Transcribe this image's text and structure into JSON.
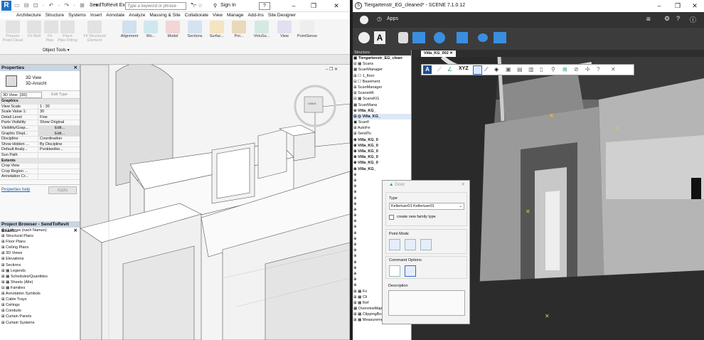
{
  "revit": {
    "logo": "R",
    "doc_title": "SendToRevit Ex...",
    "search_placeholder": "Type a keyword or phrase",
    "sign_in": "Sign In",
    "help": "?",
    "tabs": [
      "Architecture",
      "Structure",
      "Systems",
      "Insert",
      "Annotate",
      "Analyze",
      "Massing & Site",
      "Collaborate",
      "View",
      "Manage",
      "Add-Ins",
      "Site Designer"
    ],
    "ribbon": [
      {
        "label": "Prepare\nPoint Cloud",
        "grey": true
      },
      {
        "label": "Fit Wall",
        "grey": true
      },
      {
        "label": "Fit\nPipe",
        "grey": true
      },
      {
        "label": "Place\nPipe Fitting",
        "grey": true
      },
      {
        "label": "Fit Structural\nElement",
        "grey": true
      },
      {
        "label": "Alignment",
        "grey": false
      },
      {
        "label": "Wo...",
        "grey": false
      },
      {
        "label": "Model",
        "grey": false
      },
      {
        "label": "Sections",
        "grey": false
      },
      {
        "label": "Surfac...",
        "grey": false
      },
      {
        "label": "Poi...",
        "grey": false
      },
      {
        "label": "VirtuSu...",
        "grey": false
      },
      {
        "label": "View",
        "grey": false
      },
      {
        "label": "PointSense",
        "grey": false
      }
    ],
    "object_tools": "Object Tools ▾",
    "properties": {
      "header": "Properties",
      "type_name": "3D View",
      "type_sub": "3D-Ansicht",
      "selector": "3D View: {3D}",
      "edit_type": "Edit Type",
      "section_graphics": "Graphics",
      "rows": [
        [
          "View Scale",
          "1 : 30"
        ],
        [
          "Scale Value   1:",
          "30"
        ],
        [
          "Detail Level",
          "Fine"
        ],
        [
          "Parts Visibility",
          "Show Original"
        ],
        [
          "Visibility/Grap...",
          "Edit..."
        ],
        [
          "Graphic Displ...",
          "Edit..."
        ],
        [
          "Discipline",
          "Coordination"
        ],
        [
          "Show Hidden ...",
          "By Discipline"
        ],
        [
          "Default Analy...",
          "Punktwolke..."
        ],
        [
          "Sun Path",
          ""
        ]
      ],
      "section_extents": "Extents",
      "rows2": [
        [
          "Crop View",
          ""
        ],
        [
          "Crop Region ...",
          ""
        ],
        [
          "Annotation Cr...",
          ""
        ]
      ],
      "help_link": "Properties help",
      "apply": "Apply"
    },
    "project_browser": {
      "header": "Project Browser - SendToRevit Exam...",
      "items": [
        "⊟ ☐ Views (nach Namen)",
        "   ⊞ Structural Plans",
        "   ⊞ Floor Plans",
        "   ⊞ Ceiling Plans",
        "   ⊞ 3D Views",
        "   ⊞ Elevations",
        "   ⊞ Sections",
        "⊞ ▦ Legends",
        "⊞ ▦ Schedules/Quantities",
        "⊞ ▦ Sheets (Alle)",
        "⊟ ▦ Families",
        "   ⊞ Annotation Symbols",
        "   ⊞ Cable Trays",
        "   ⊞ Ceilings",
        "   ⊞ Conduits",
        "   ⊞ Curtain Panels",
        "   ⊞ Curtain Systems"
      ]
    },
    "viewcube_label": "LINKS"
  },
  "scene": {
    "title": "Tiergartenstr_EG_cleaned* - SCENE 7.1.0.12",
    "apps": "Apps",
    "structure_header": "Structure",
    "view_tab": "Villa_KG_002",
    "tree": [
      "▣ Tiergartenstr_EG_clean",
      " ⊟ ▦ Scans",
      "   ▦ ScanManager",
      " ⊞ ☐ 1_floor",
      " ⊟ ☐ Basement",
      "   ⊞ ScanManager",
      "   ⊞ ScansHK",
      "   ⊟ ▦ ScansKG",
      "     ▦ ScanMana",
      "     ⊖ Villa_KG_",
      "     ⊟ ◎ Villa_KG_",
      "       ▣ ScanF",
      "       ⊞ AutoFe",
      "       ⊞ SendTo",
      "     ⊕ Villa_KG_0",
      "     ⊕ Villa_KG_0",
      "     ⊕ Villa_KG_0",
      "     ⊕ Villa_KG_0",
      "     ⊕ Villa_KG_0",
      "     ⊕ Villa_KG_",
      "     ⊕",
      "     ⊕",
      "     ⊕",
      "     ⊕",
      "     ⊕",
      "     ⊕",
      "     ⊕",
      "     ⊕",
      "     ⊕",
      "     ⊕",
      "     ⊕",
      "     ⊕",
      "     ⊕",
      "     ⊕",
      "     ⊕",
      "     ⊕",
      "     ⊕",
      "     ⊕",
      "     ⊕",
      "     ⊕",
      " ⊞ ▦ Fo",
      " ⊞ ▦ Cli",
      " ⊞ ▦ Ref",
      " ▦ OverviewMap",
      " ⊞ ▦ ClippingBoxes",
      " ⊞ ▦ Measurements"
    ],
    "door_dialog": {
      "title": "Door",
      "type_label": "Type",
      "type_value": "Kellertuer01 Kellertuer01",
      "create_new": "create new family type",
      "point_mode": "Point Mode",
      "command_options": "Command Options",
      "description": "Description"
    }
  }
}
